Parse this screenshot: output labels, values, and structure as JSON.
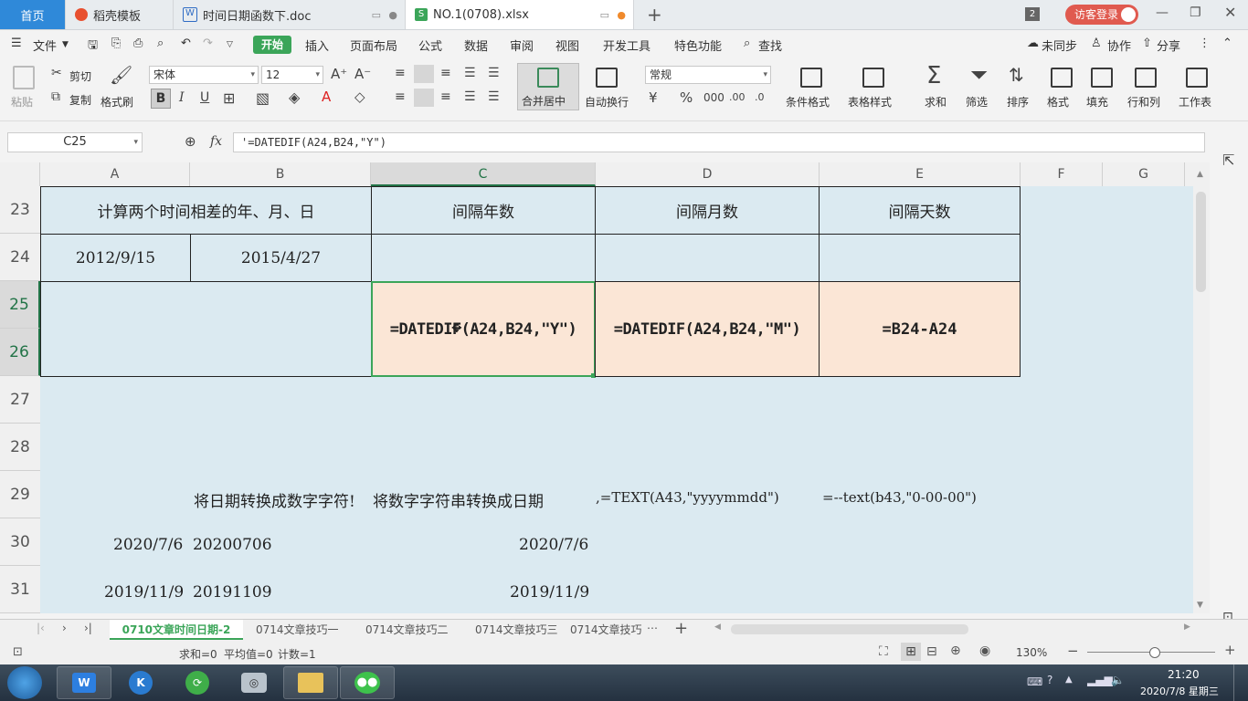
{
  "titlebar": {
    "tabs": [
      {
        "label": "首页"
      },
      {
        "label": "稻壳模板"
      },
      {
        "label": "时间日期函数下.doc"
      },
      {
        "label": "NO.1(0708).xlsx"
      }
    ],
    "window_count": "2",
    "login_label": "访客登录"
  },
  "menubar": {
    "file": "文件",
    "start": "开始",
    "items": [
      "插入",
      "页面布局",
      "公式",
      "数据",
      "审阅",
      "视图",
      "开发工具",
      "特色功能"
    ],
    "search": "查找",
    "sync": "未同步",
    "collab": "协作",
    "share": "分享"
  },
  "ribbon": {
    "paste": "粘贴",
    "cut": "剪切",
    "copy": "复制",
    "format_painter": "格式刷",
    "font_name": "宋体",
    "font_size": "12",
    "bold": "B",
    "italic": "I",
    "underline": "U",
    "merge_center": "合并居中",
    "wrap_text": "自动换行",
    "number_format": "常规",
    "cond_format": "条件格式",
    "table_style": "表格样式",
    "sum": "求和",
    "filter": "筛选",
    "sort": "排序",
    "format": "格式",
    "fill": "填充",
    "row_col": "行和列",
    "worksheet": "工作表"
  },
  "formula_bar": {
    "name_box": "C25",
    "fx": "fx",
    "formula": "'=DATEDIF(A24,B24,\"Y\")"
  },
  "columns": [
    "A",
    "B",
    "C",
    "D",
    "E",
    "F",
    "G"
  ],
  "rows": [
    "23",
    "24",
    "25",
    "26",
    "27",
    "28",
    "29",
    "30",
    "31"
  ],
  "cells": {
    "r23_ab": "计算两个时间相差的年、月、日",
    "r23_c": "间隔年数",
    "r23_d": "间隔月数",
    "r23_e": "间隔天数",
    "r24_a": "2012/9/15",
    "r24_b": "2015/4/27",
    "r25_c": "=DATEDIF(A24,B24,\"Y\")",
    "r25_d": "=DATEDIF(A24,B24,\"M\")",
    "r25_e": "=B24-A24",
    "r29_b": "将日期转换成数字字符!",
    "r29_c": "将数字字符串转换成日期",
    "r29_d": ",=TEXT(A43,\"yyyymmdd\")",
    "r29_e": "=--text(b43,\"0-00-00\")",
    "r30_a": "2020/7/6",
    "r30_b": "20200706",
    "r30_c": "2020/7/6",
    "r31_a": "2019/11/9",
    "r31_b": "20191109",
    "r31_c": "2019/11/9"
  },
  "sheet_tabs": [
    "0710文章时间日期-2",
    "0714文章技巧一",
    "0714文章技巧二",
    "0714文章技巧三",
    "0714文章技巧"
  ],
  "status": {
    "sum": "求和=0",
    "avg": "平均值=0",
    "count": "计数=1",
    "zoom": "130%"
  },
  "taskbar": {
    "time": "21:20",
    "date": "2020/7/8 星期三"
  },
  "colors": {
    "accent_green": "#3ba559",
    "sheet_bg": "#dbeaf1",
    "peach": "#fbe6d6",
    "home_tab": "#2f89d9"
  }
}
